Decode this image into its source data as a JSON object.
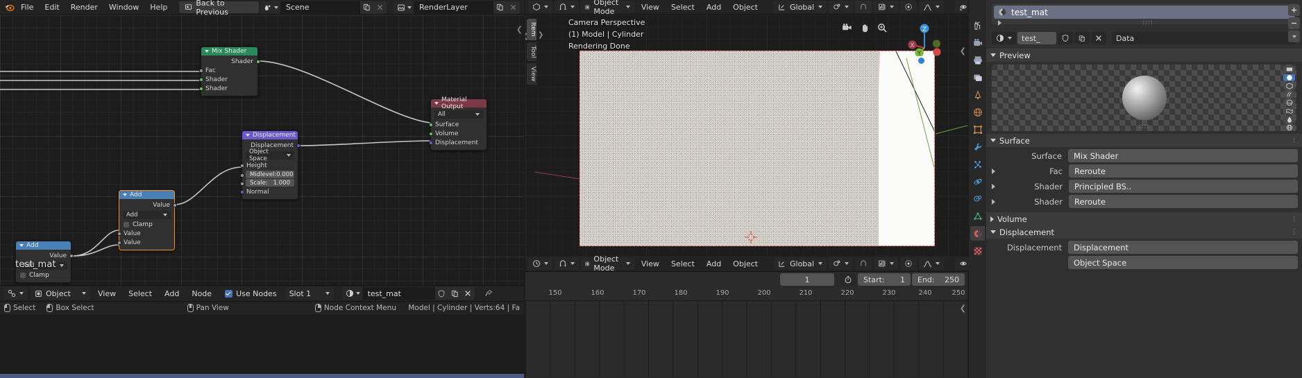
{
  "topbar": {
    "logo_icon": "blender-logo-icon",
    "menus": [
      "File",
      "Edit",
      "Render",
      "Window",
      "Help"
    ],
    "back_to_previous": "Back to Previous",
    "back_icon": "back-to-previous-icon",
    "scene": {
      "icon": "scene-icon",
      "name": "Scene",
      "new_icon": "new-copy-icon",
      "unlink_icon": "unlink-x-icon"
    },
    "viewlayer": {
      "icon": "viewlayer-icon",
      "name": "RenderLayer",
      "new_icon": "new-copy-icon",
      "unlink_icon": "unlink-x-icon"
    }
  },
  "node_editor": {
    "float_label": "test_mat",
    "nodes": [
      {
        "name": "Mix Shader",
        "header_color": "#2b8a5b",
        "outputs": [
          "Shader"
        ],
        "inputs": [
          "Fac",
          "Shader",
          "Shader"
        ]
      },
      {
        "name": "Material Output",
        "header_color": "#7a3944",
        "select": "All",
        "inputs": [
          "Surface",
          "Volume",
          "Displacement"
        ]
      },
      {
        "name": "Displacement",
        "header_color": "#6a5acd",
        "outputs": [
          "Displacement"
        ],
        "select": "Object Space",
        "inputs": [
          "Height",
          "Normal"
        ],
        "values": [
          {
            "label": "Midlevel:",
            "value": "0.000"
          },
          {
            "label": "Scale:",
            "value": "1.000"
          }
        ]
      },
      {
        "name": "Add",
        "header_color": "#4a7fb5",
        "outputs": [
          "Value"
        ],
        "select": "Add",
        "checkbox": "Clamp",
        "inputs": [
          "Value",
          "Value"
        ]
      },
      {
        "name": "Add",
        "header_color": "#4a7fb5",
        "outputs": [
          "Value"
        ],
        "select": "Add",
        "checkbox": "Clamp",
        "inputs": [
          "Value",
          "Value"
        ]
      }
    ],
    "header": {
      "editor_icon": "node-editor-icon",
      "shader_type_icon": "object-shading-icon",
      "shader_type": "Object",
      "menus": [
        "View",
        "Select",
        "Add",
        "Node"
      ],
      "use_nodes": "Use Nodes",
      "slot": "Slot 1",
      "material_icon": "material-sphere-icon",
      "material_name": "test_mat",
      "fake_user_icon": "shield-fake-user-icon",
      "new_icon": "new-copy-icon",
      "unlink_icon": "unlink-x-icon",
      "pin_icon": "pin-icon"
    }
  },
  "statusbar": {
    "items": [
      {
        "icon": "mouse-left-icon",
        "label": "Select"
      },
      {
        "icon": "mouse-left-drag-icon",
        "label": "Box Select"
      },
      {
        "icon": "mouse-middle-icon",
        "label": "Pan View"
      },
      {
        "icon": "mouse-right-icon",
        "label": "Node Context Menu"
      }
    ],
    "scene_stats": "Model | Cylinder | Verts:64 | Fa"
  },
  "viewport": {
    "header": {
      "editor_icon": "3d-viewport-icon",
      "snap_icon": "snap-magnet-icon",
      "mode_icon": "object-mode-icon",
      "mode": "Object Mode",
      "menus": [
        "View",
        "Select",
        "Add",
        "Object"
      ],
      "orientation_icon": "transform-orientation-icon",
      "orientation": "Global",
      "pivot_icon": "pivot-point-icon",
      "magnet_icon": "snap-magnet-icon",
      "proportional_icon": "proportional-edit-icon",
      "falloff_icon": "proportional-falloff-icon",
      "visibility_icon": "object-visibility-icon",
      "gizmo_icon": "show-gizmo-icon",
      "overlays_icon": "show-overlays-icon"
    },
    "tabs": [
      "Item",
      "Tool",
      "View"
    ],
    "active_tab": "Item",
    "overlay": {
      "view_name": "Camera Perspective",
      "object_info": "(1) Model | Cylinder",
      "render_status": "Rendering Done"
    },
    "nav_icons": [
      "camera-view-icon",
      "pan-hand-icon",
      "zoom-magnifier-icon"
    ],
    "axis_gizmo": {
      "z": "Z",
      "x": "X",
      "y": "Y"
    }
  },
  "timeline": {
    "header": {
      "editor_icon": "timeline-icon",
      "mode_icon": "object-mode-icon",
      "mode": "Object Mode",
      "menus": [
        "View",
        "Select",
        "Add",
        "Object"
      ],
      "orientation_icon": "transform-orientation-icon",
      "orientation": "Global",
      "pivot_icon": "pivot-point-icon",
      "magnet_icon": "snap-magnet-icon",
      "proportional_icon": "proportional-edit-icon",
      "falloff_icon": "proportional-falloff-icon",
      "visibility_icon": "object-visibility-icon",
      "gizmo_icon": "show-gizmo-icon",
      "overlays_icon": "show-overlays-icon"
    },
    "current_frame": "1",
    "timer_icon": "auto-keying-timer-icon",
    "start_label": "Start:",
    "start_value": "1",
    "end_label": "End:",
    "end_value": "250",
    "ticks": [
      "150",
      "160",
      "170",
      "180",
      "190",
      "200",
      "210",
      "220",
      "230",
      "240",
      "250"
    ]
  },
  "properties": {
    "tabs": [
      {
        "icon": "tool-wrench-icon",
        "active": false
      },
      {
        "icon": "render-camera-icon",
        "active": false
      },
      {
        "icon": "output-printer-icon",
        "active": false
      },
      {
        "icon": "viewlayer-images-icon",
        "active": false
      },
      {
        "icon": "scene-cone-icon",
        "active": false
      },
      {
        "icon": "world-globe-icon",
        "active": false
      },
      {
        "icon": "object-square-icon",
        "active": false
      },
      {
        "icon": "modifier-wrench-icon",
        "active": false
      },
      {
        "icon": "particles-icon",
        "active": false
      },
      {
        "icon": "physics-orbit-icon",
        "active": false
      },
      {
        "icon": "constraints-icon",
        "active": false
      },
      {
        "icon": "object-data-triangle-icon",
        "active": false
      },
      {
        "icon": "material-sphere-icon",
        "active": true
      },
      {
        "icon": "texture-checker-icon",
        "active": false
      }
    ],
    "material_slot": {
      "icon": "material-sphere-icon",
      "name": "test_mat",
      "add_icon": "plus-icon",
      "remove_icon": "minus-icon",
      "menu_icon": "chevron-down-icon",
      "grip": "::::",
      "expand_icon": "expand-arrow-icon"
    },
    "material_id": {
      "browse_icon": "material-sphere-icon",
      "name": "test_",
      "fake_user_icon": "shield-fake-user-icon",
      "new_icon": "new-copy-icon",
      "unlink_icon": "unlink-x-icon",
      "type": "Data",
      "type_chevron": "chevron-down-icon"
    },
    "preview": {
      "title": "Preview",
      "shapes": [
        "flat-plane-icon",
        "sphere-icon",
        "cube-icon",
        "hair-icon",
        "shader-ball-icon",
        "cloth-icon",
        "fluid-icon",
        "world-icon"
      ],
      "active_shape_index": 1,
      "grip": "::::"
    },
    "surface": {
      "title": "Surface",
      "rows": [
        {
          "label": "Surface",
          "value": "Mix Shader",
          "expandable": false
        },
        {
          "label": "Fac",
          "value": "Reroute",
          "expandable": true
        },
        {
          "label": "Shader",
          "value": "Principled BS..",
          "expandable": true
        },
        {
          "label": "Shader",
          "value": "Reroute",
          "expandable": true
        }
      ]
    },
    "volume": {
      "title": "Volume",
      "collapsed": true
    },
    "displacement": {
      "title": "Displacement",
      "collapsed": false,
      "rows": [
        {
          "label": "Displacement",
          "value": "Displacement",
          "expandable": false
        }
      ],
      "space": "Object Space"
    }
  }
}
